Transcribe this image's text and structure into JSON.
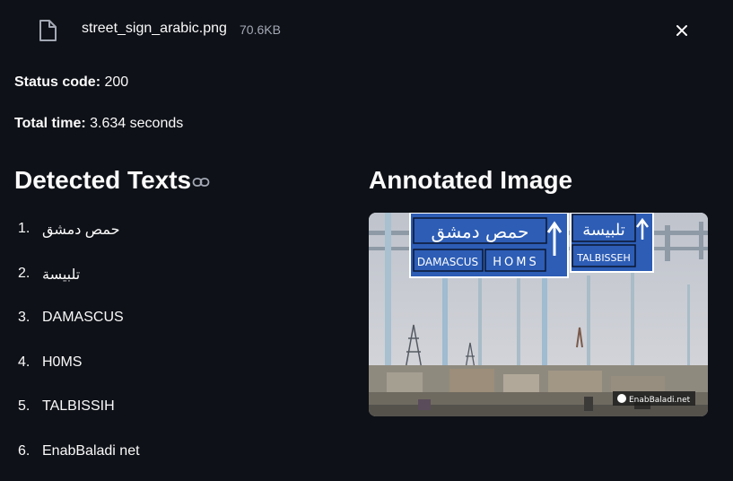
{
  "file": {
    "name": "street_sign_arabic.png",
    "size": "70.6KB",
    "icon": "file-icon",
    "close_icon": "close-icon"
  },
  "status": {
    "label": "Status code:",
    "value": "200"
  },
  "total_time": {
    "label": "Total time:",
    "value": "3.634 seconds"
  },
  "detected": {
    "heading": "Detected Texts",
    "link_icon": "link-icon",
    "items": [
      {
        "num": "1.",
        "text": "حمص دمشق"
      },
      {
        "num": "2.",
        "text": "تلبيسة"
      },
      {
        "num": "3.",
        "text": "DAMASCUS"
      },
      {
        "num": "4.",
        "text": "H0MS"
      },
      {
        "num": "5.",
        "text": "TALBISSIH"
      },
      {
        "num": "6.",
        "text": "EnabBaladi net"
      }
    ]
  },
  "annotated": {
    "heading": "Annotated Image",
    "sign_arabic_1": "حمص دمشق",
    "sign_arabic_2": "تلبيسة",
    "sign_en_1": "DAMASCUS",
    "sign_en_2": "HOMS",
    "sign_en_3": "TALBISSEH",
    "watermark": "EnabBaladi.net"
  },
  "colors": {
    "background": "#0e1117",
    "text": "#fafafa",
    "muted": "#a3a8b4",
    "sign_blue": "#2d5db5"
  }
}
